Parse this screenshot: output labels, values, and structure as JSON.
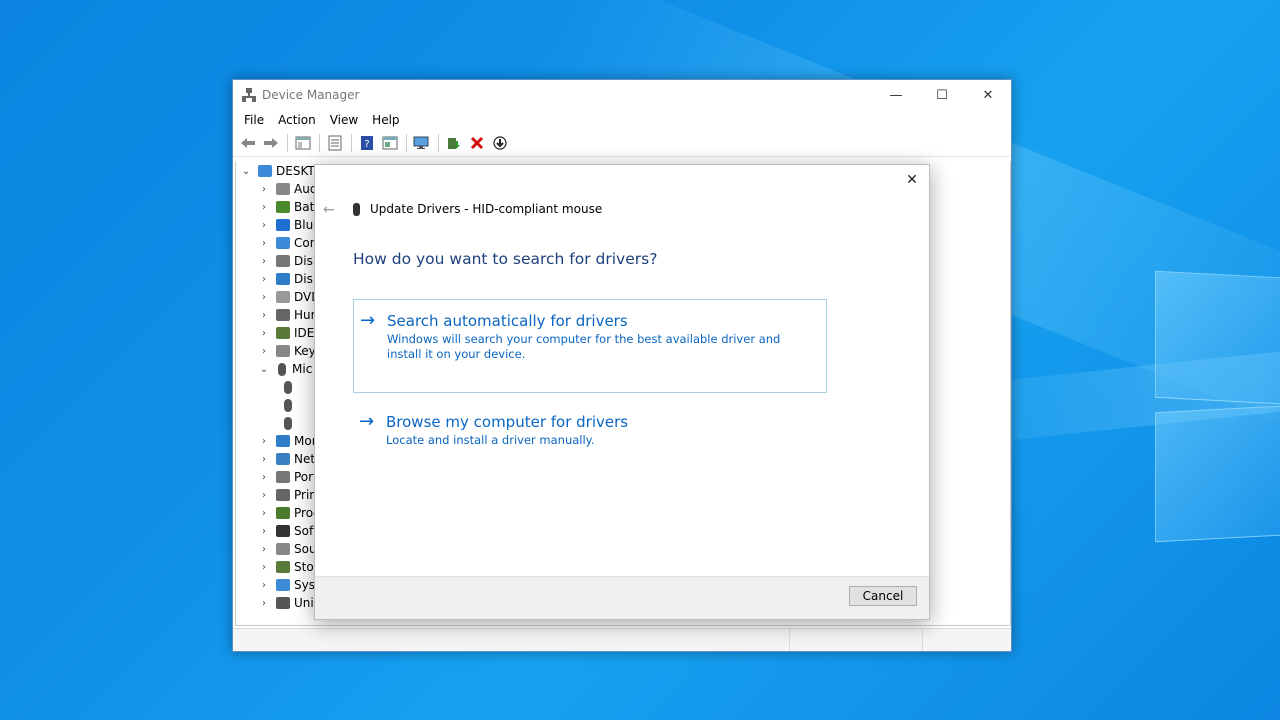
{
  "window": {
    "title": "Device Manager",
    "minimize_glyph": "—",
    "maximize_glyph": "☐",
    "close_glyph": "✕"
  },
  "menu": [
    "File",
    "Action",
    "View",
    "Help"
  ],
  "toolbar": {
    "icons": [
      "back-icon",
      "forward-icon",
      "show-hide-tree-icon",
      "properties-icon",
      "help-icon",
      "view-icon",
      "scan-hardware-icon",
      "update-driver-icon",
      "uninstall-icon",
      "disable-icon"
    ]
  },
  "tree": {
    "root": "DESKTO",
    "items": [
      {
        "label": "Aud",
        "expanded": false,
        "icon": "audio-icon",
        "color": "#888888"
      },
      {
        "label": "Batt",
        "expanded": false,
        "icon": "battery-icon",
        "color": "#4a8a2c"
      },
      {
        "label": "Blue",
        "expanded": false,
        "icon": "bluetooth-icon",
        "color": "#1f6fd1"
      },
      {
        "label": "Com",
        "expanded": false,
        "icon": "computer-icon",
        "color": "#3c8ad8"
      },
      {
        "label": "Disk",
        "expanded": false,
        "icon": "disk-icon",
        "color": "#777777"
      },
      {
        "label": "Disp",
        "expanded": false,
        "icon": "display-icon",
        "color": "#2f7cc9"
      },
      {
        "label": "DVD",
        "expanded": false,
        "icon": "dvd-icon",
        "color": "#999999"
      },
      {
        "label": "Hum",
        "expanded": false,
        "icon": "hid-icon",
        "color": "#666666"
      },
      {
        "label": "IDE",
        "expanded": false,
        "icon": "ide-icon",
        "color": "#5a7a3a"
      },
      {
        "label": "Keyb",
        "expanded": false,
        "icon": "keyboard-icon",
        "color": "#888888"
      },
      {
        "label": "Mic",
        "expanded": true,
        "icon": "mouse-icon",
        "color": "#555555"
      },
      {
        "label": "",
        "child": true,
        "icon": "mouse-icon",
        "color": "#555555"
      },
      {
        "label": "",
        "child": true,
        "icon": "mouse-icon",
        "color": "#555555"
      },
      {
        "label": "",
        "child": true,
        "icon": "mouse-icon",
        "color": "#555555"
      },
      {
        "label": "Mon",
        "expanded": false,
        "icon": "monitor-icon",
        "color": "#2f7cc9"
      },
      {
        "label": "Net",
        "expanded": false,
        "icon": "network-icon",
        "color": "#3a7fbf"
      },
      {
        "label": "Port",
        "expanded": false,
        "icon": "port-icon",
        "color": "#777777"
      },
      {
        "label": "Prin",
        "expanded": false,
        "icon": "printer-icon",
        "color": "#666666"
      },
      {
        "label": "Proc",
        "expanded": false,
        "icon": "processor-icon",
        "color": "#4a7a2c"
      },
      {
        "label": "Soft",
        "expanded": false,
        "icon": "software-icon",
        "color": "#333333"
      },
      {
        "label": "Sou",
        "expanded": false,
        "icon": "sound-icon",
        "color": "#888888"
      },
      {
        "label": "Stor",
        "expanded": false,
        "icon": "storage-icon",
        "color": "#5a7a3a"
      },
      {
        "label": "Syst",
        "expanded": false,
        "icon": "system-icon",
        "color": "#3c8ad8"
      },
      {
        "label": "Univ",
        "expanded": false,
        "icon": "usb-icon",
        "color": "#555555"
      }
    ]
  },
  "dialog": {
    "title": "Update Drivers - HID-compliant mouse",
    "question": "How do you want to search for drivers?",
    "close_glyph": "✕",
    "back_glyph": "←",
    "options": [
      {
        "arrow": "→",
        "title": "Search automatically for drivers",
        "description": "Windows will search your computer for the best available driver and install it on your device."
      },
      {
        "arrow": "→",
        "title": "Browse my computer for drivers",
        "description": "Locate and install a driver manually."
      }
    ],
    "cancel_label": "Cancel"
  }
}
